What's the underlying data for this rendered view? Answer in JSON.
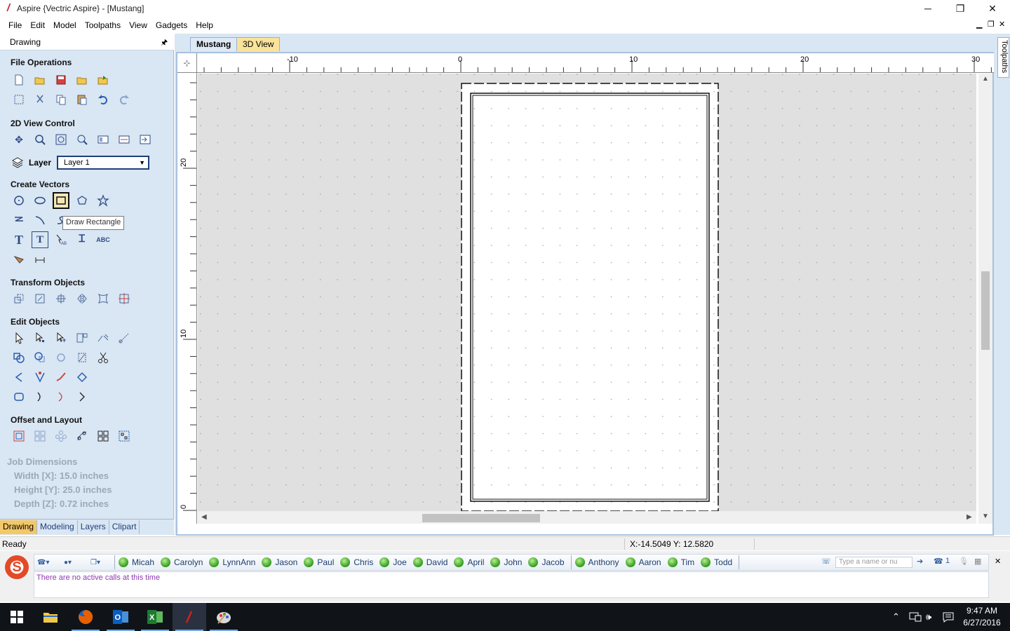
{
  "window": {
    "title": "Aspire {Vectric Aspire} - [Mustang]",
    "minimize": "─",
    "restore": "❐",
    "close": "✕"
  },
  "menu": [
    "File",
    "Edit",
    "Model",
    "Toolpaths",
    "View",
    "Gadgets",
    "Help"
  ],
  "mdi_controls": [
    "▁",
    "❐",
    "✕"
  ],
  "left_panel": {
    "title": "Drawing",
    "pin": "🖈",
    "sections": {
      "file_operations": "File Operations",
      "view_control": "2D View Control",
      "create_vectors": "Create Vectors",
      "transform_objects": "Transform Objects",
      "edit_objects": "Edit Objects",
      "offset_layout": "Offset and Layout"
    },
    "layer_label": "Layer",
    "layer_value": "Layer 1",
    "tooltip": "Draw Rectangle",
    "job_dimensions": {
      "title": "Job Dimensions",
      "width": "Width  [X]: 15.0 inches",
      "height": "Height [Y]: 25.0 inches",
      "depth": "Depth  [Z]: 0.72 inches"
    },
    "tabs": [
      "Drawing",
      "Modeling",
      "Layers",
      "Clipart"
    ]
  },
  "doc_tabs": {
    "active": "Mustang",
    "other": "3D View"
  },
  "rulers": {
    "h_labels": [
      "-10",
      "0",
      "10",
      "20",
      "30"
    ],
    "v_labels": [
      "20",
      "10",
      "0"
    ]
  },
  "right_strip": {
    "tab": "Toolpaths"
  },
  "status": {
    "ready": "Ready",
    "coords": "X:-14.5049 Y: 12.5820"
  },
  "phone": {
    "contacts_group1": [
      "Micah",
      "Carolyn",
      "LynnAnn",
      "Jason",
      "Paul",
      "Chris",
      "Joe",
      "David",
      "April",
      "John",
      "Jacob"
    ],
    "contacts_group2": [
      "Anthony",
      "Aaron",
      "Tim",
      "Todd"
    ],
    "search_placeholder": "Type a name or nu",
    "call_count": "1",
    "message": "There are no active calls at this time"
  },
  "taskbar": {
    "time": "9:47 AM",
    "date": "6/27/2016"
  },
  "colors": {
    "panel_bg": "#d9e6f3",
    "active_tab": "#f3c868",
    "canvas": "#e0e0e0"
  }
}
